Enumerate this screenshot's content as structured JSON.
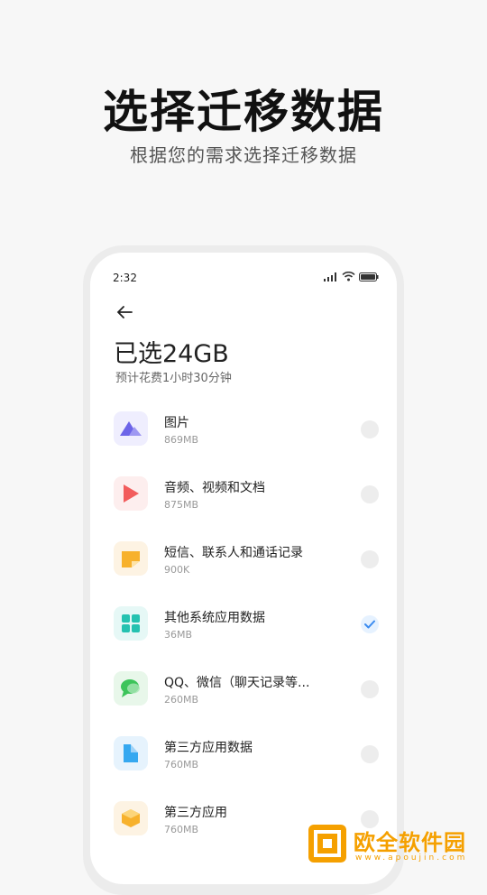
{
  "headline": "选择迁移数据",
  "subline": "根据您的需求选择迁移数据",
  "phone": {
    "status_time": "2:32",
    "selected_title": "已选24GB",
    "estimate": "预计花费1小时30分钟",
    "items": [
      {
        "title": "图片",
        "size": "869MB",
        "icon": "image-icon",
        "checked": false
      },
      {
        "title": "音频、视频和文档",
        "size": "875MB",
        "icon": "play-icon",
        "checked": false
      },
      {
        "title": "短信、联系人和通话记录",
        "size": "900K",
        "icon": "message-icon",
        "checked": false
      },
      {
        "title": "其他系统应用数据",
        "size": "36MB",
        "icon": "apps-grid-icon",
        "checked": true
      },
      {
        "title": "QQ、微信（聊天记录等...",
        "size": "260MB",
        "icon": "chat-icon",
        "checked": false
      },
      {
        "title": "第三方应用数据",
        "size": "760MB",
        "icon": "file-icon",
        "checked": false
      },
      {
        "title": "第三方应用",
        "size": "760MB",
        "icon": "cube-icon",
        "checked": false
      }
    ]
  },
  "watermark": {
    "name": "欧全软件园",
    "url": "www.apoujin.com"
  },
  "colors": {
    "accent": "#3a8bf0",
    "logo": "#f5a000"
  }
}
